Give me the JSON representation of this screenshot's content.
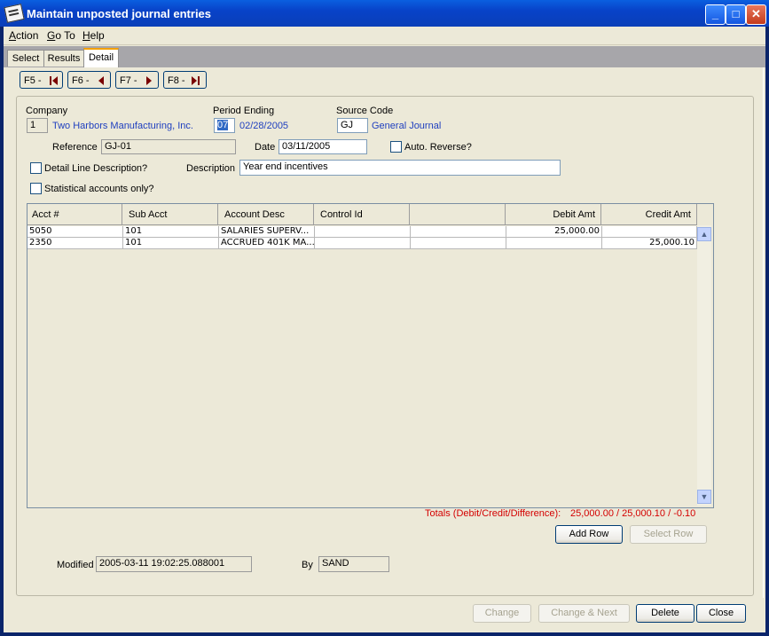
{
  "window": {
    "title": "Maintain unposted journal entries"
  },
  "titlebar_buttons": [
    "minimize-icon",
    "maximize-icon",
    "close-icon"
  ],
  "menu": [
    {
      "label": "Action",
      "mnemonic": "A",
      "rest": "ction"
    },
    {
      "label": "Go To",
      "mnemonic": "G",
      "rest": "o To"
    },
    {
      "label": "Help",
      "mnemonic": "H",
      "rest": "elp"
    }
  ],
  "tabs": [
    "Select",
    "Results",
    "Detail"
  ],
  "active_tab": "Detail",
  "nav": {
    "first": "F5 -",
    "prev": "F6 -",
    "next": "F7 -",
    "last": "F8 -"
  },
  "form": {
    "company_label": "Company",
    "company_id": "1",
    "company_name": "Two Harbors Manufacturing, Inc.",
    "period_label": "Period Ending",
    "period_num": "07",
    "period_date": "02/28/2005",
    "source_label": "Source Code",
    "source_code": "GJ",
    "source_name": "General Journal",
    "reference_label": "Reference",
    "reference": "GJ-01",
    "date_label": "Date",
    "date": "03/11/2005",
    "auto_reverse_label": "Auto. Reverse?",
    "detail_desc_label": "Detail Line Description?",
    "description_label": "Description",
    "description": "Year end incentives",
    "statistical_label": "Statistical accounts only?"
  },
  "grid": {
    "columns": [
      "Acct #",
      "Sub Acct",
      "Account Desc",
      "Control Id",
      "",
      "Debit Amt",
      "Credit Amt"
    ],
    "rows": [
      [
        "5050",
        "101",
        "SALARIES SUPERV...",
        "",
        "",
        "25,000.00",
        ""
      ],
      [
        "2350",
        "101",
        "ACCRUED 401K MA...",
        "",
        "",
        "",
        "25,000.10"
      ]
    ]
  },
  "totals": {
    "label": "Totals (Debit/Credit/Difference):",
    "value": "25,000.00 / 25,000.10 / -0.10",
    "color": "#d40000"
  },
  "grid_buttons": {
    "add_row": "Add Row",
    "select_row": "Select Row"
  },
  "audit": {
    "modified_label": "Modified",
    "modified": "2005-03-11 19:02:25.088001",
    "by_label": "By",
    "by": "SAND"
  },
  "footer_buttons": {
    "change": "Change",
    "change_next": "Change & Next",
    "delete": "Delete",
    "close": "Close"
  }
}
